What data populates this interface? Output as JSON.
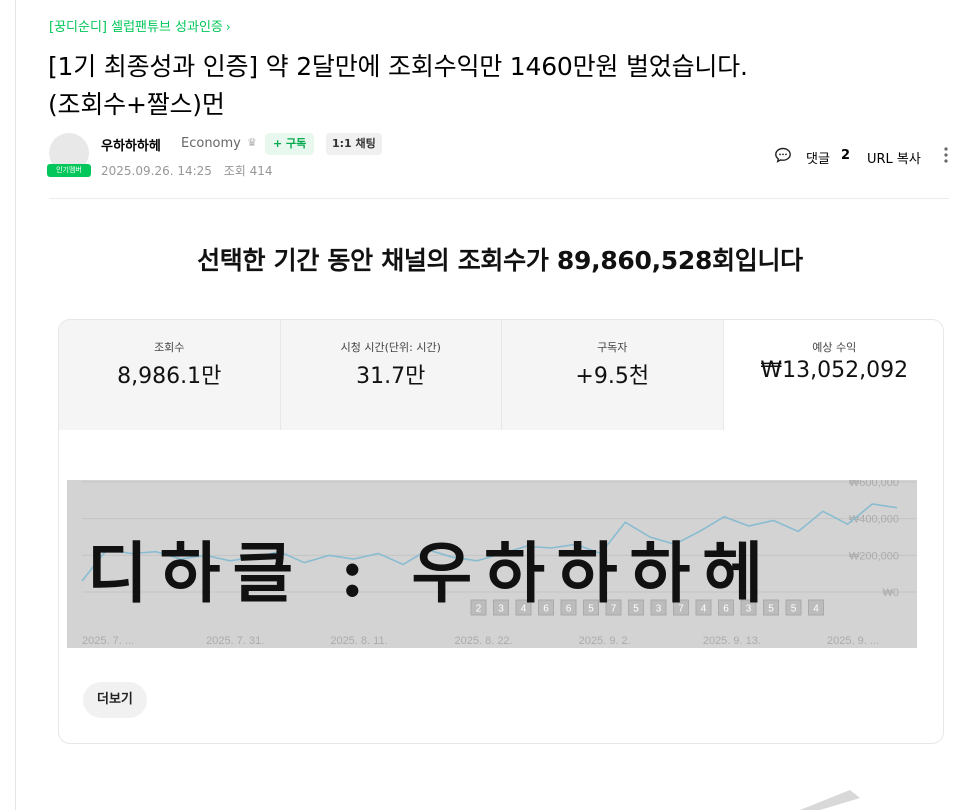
{
  "board": {
    "link_label": "[꿍디순디] 셀럽팬튜브 성과인증",
    "chevron": "›"
  },
  "post": {
    "title_line1": "[1기 최종성과 인증] 약 2달만에 조회수익만 1460만원 벌었습니다.",
    "title_line2": "(조회수+짤스)먼"
  },
  "author": {
    "nickname": "우하하하헤",
    "grade": "Economy",
    "grade_icon": "crown-icon",
    "badge": "인기멤버",
    "subscribe_label": "+ 구독",
    "chat_label": "1:1 채팅",
    "date": "2025.09.26. 14:25",
    "views_label": "조회 414"
  },
  "tools": {
    "comment_label": "댓글",
    "comment_count": "2",
    "url_copy_label": "URL 복사"
  },
  "content": {
    "headline": "선택한 기간 동안 채널의 조회수가 89,860,528회입니다",
    "stats": [
      {
        "label": "조회수",
        "value": "8,986.1만"
      },
      {
        "label": "시청 시간(단위: 시간)",
        "value": "31.7만"
      },
      {
        "label": "구독자",
        "value": "+9.5천"
      },
      {
        "label": "예상 수익",
        "value": "₩13,052,092"
      }
    ],
    "more_label": "더보기",
    "watermark": "디하클 : 우하하하헤"
  },
  "chart_data": {
    "type": "line",
    "y_tick_labels": [
      "₩600,000",
      "₩400,000",
      "₩200,000",
      "₩0"
    ],
    "y_values": [
      600000,
      400000,
      200000,
      0
    ],
    "x_tick_labels": [
      "2025. 7. ...",
      "2025. 7. 31.",
      "2025. 8. 11.",
      "2025. 8. 22.",
      "2025. 9. 2.",
      "2025. 9. 13.",
      "2025. 9. ..."
    ],
    "marker_labels": [
      "2",
      "3",
      "4",
      "6",
      "6",
      "5",
      "7",
      "5",
      "3",
      "7",
      "4",
      "6",
      "3",
      "5",
      "5",
      "4"
    ],
    "series": [
      {
        "values": [
          60000,
          230000,
          210000,
          220000,
          180000,
          200000,
          170000,
          190000,
          220000,
          160000,
          200000,
          180000,
          210000,
          150000,
          230000,
          190000,
          170000,
          210000,
          250000,
          240000,
          260000,
          210000,
          380000,
          300000,
          260000,
          330000,
          410000,
          360000,
          390000,
          330000,
          440000,
          370000,
          480000,
          460000
        ]
      }
    ],
    "ylim": [
      0,
      600000
    ],
    "grid": true
  },
  "colors": {
    "brand_green": "#03c75a",
    "line": "#89bcd1",
    "chart_bg": "#d3d3d3"
  }
}
